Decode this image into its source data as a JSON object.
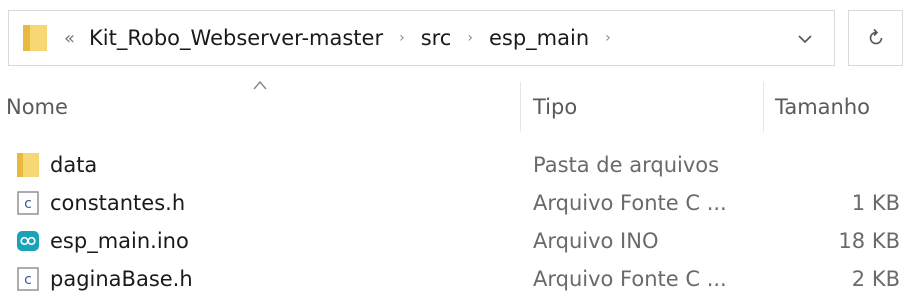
{
  "address": {
    "overflow_glyph": "«",
    "segments": [
      "Kit_Robo_Webserver-master",
      "src",
      "esp_main"
    ],
    "separator_glyph": "›"
  },
  "icons": {
    "address_folder": "folder-icon",
    "dropdown": "chevron-down-icon",
    "refresh": "refresh-icon",
    "sort": "sort-up-icon"
  },
  "columns": {
    "name": "Nome",
    "type": "Tipo",
    "size": "Tamanho"
  },
  "files": [
    {
      "name": "data",
      "type": "Pasta de arquivos",
      "size": "",
      "icon": "folder-icon"
    },
    {
      "name": "constantes.h",
      "type": "Arquivo Fonte C ...",
      "size": "1 KB",
      "icon": "c-source-file-icon"
    },
    {
      "name": "esp_main.ino",
      "type": "Arquivo INO",
      "size": "18 KB",
      "icon": "arduino-file-icon"
    },
    {
      "name": "paginaBase.h",
      "type": "Arquivo Fonte C ...",
      "size": "2 KB",
      "icon": "c-source-file-icon"
    }
  ],
  "colors": {
    "folder": "#f7d774",
    "arduino": "#1aa3b8",
    "border": "#d9d9d9"
  }
}
